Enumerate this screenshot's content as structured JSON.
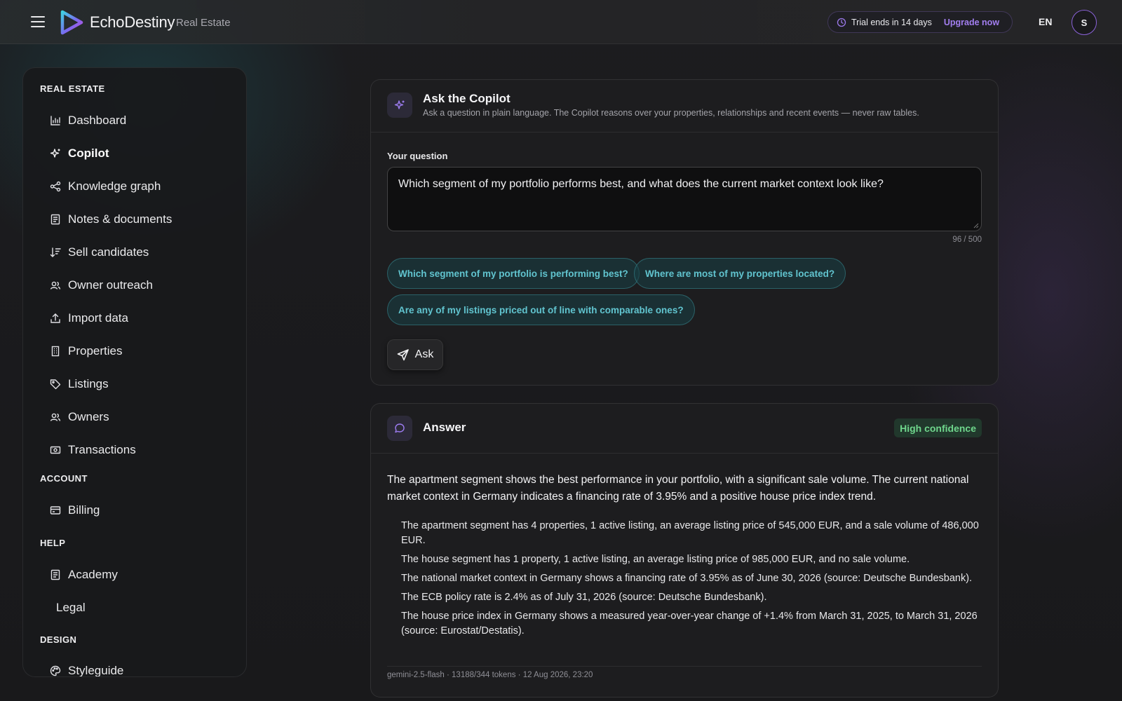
{
  "header": {
    "brand_name": "EchoDestiny",
    "brand_sub": "Real Estate",
    "trial_text": "Trial ends in 14 days",
    "upgrade_label": "Upgrade now",
    "language": "EN",
    "avatar_initial": "S"
  },
  "sidebar": {
    "sections": {
      "real_estate": "REAL ESTATE",
      "account": "ACCOUNT",
      "help": "HELP",
      "design": "DESIGN"
    },
    "items": {
      "dashboard": "Dashboard",
      "copilot": "Copilot",
      "knowledge_graph": "Knowledge graph",
      "notes": "Notes & documents",
      "sell_candidates": "Sell candidates",
      "owner_outreach": "Owner outreach",
      "import_data": "Import data",
      "properties": "Properties",
      "listings": "Listings",
      "owners": "Owners",
      "transactions": "Transactions",
      "billing": "Billing",
      "academy": "Academy",
      "legal": "Legal",
      "styleguide": "Styleguide"
    },
    "active_item": "Copilot"
  },
  "ask_card": {
    "title": "Ask the Copilot",
    "subtitle": "Ask a question in plain language. The Copilot reasons over your properties, relationships and recent events — never raw tables.",
    "question_label": "Your question",
    "question_value": "Which segment of my portfolio performs best, and what does the current market context look like?",
    "char_count": "96 / 500",
    "suggestions": [
      "Which segment of my portfolio is performing best?",
      "Where are most of my properties located?",
      "Are any of my listings priced out of line with comparable ones?"
    ],
    "ask_label": "Ask"
  },
  "answer_card": {
    "title": "Answer",
    "confidence": "High confidence",
    "lead": "The apartment segment shows the best performance in your portfolio, with a significant sale volume. The current national market context in Germany indicates a financing rate of 3.95% and a positive house price index trend.",
    "bullets": [
      "The apartment segment has 4 properties, 1 active listing, an average listing price of 545,000 EUR, and a sale volume of 486,000 EUR.",
      "The house segment has 1 property, 1 active listing, an average listing price of 985,000 EUR, and no sale volume.",
      "The national market context in Germany shows a financing rate of 3.95% as of June 30, 2026 (source: Deutsche Bundesbank).",
      "The ECB policy rate is 2.4% as of July 31, 2026 (source: Deutsche Bundesbank).",
      "The house price index in Germany shows a measured year-over-year change of +1.4% from March 31, 2025, to March 31, 2026 (source: Eurostat/Destatis)."
    ],
    "meta": "gemini-2.5-flash · 13188/344 tokens · 12 Aug 2026, 23:20"
  },
  "colors": {
    "accent_purple": "#a27ef0",
    "chip_teal": "#61c4cf",
    "confidence_green": "#6fd68c"
  }
}
